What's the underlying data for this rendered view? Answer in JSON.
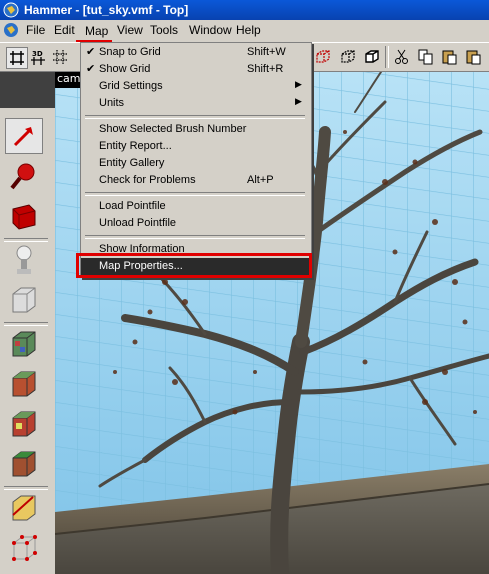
{
  "window": {
    "title": "Hammer - [tut_sky.vmf - Top]"
  },
  "menubar": {
    "items": [
      "File",
      "Edit",
      "Map",
      "View",
      "Tools",
      "Window",
      "Help"
    ]
  },
  "viewport": {
    "tab_label": "cam"
  },
  "map_menu": {
    "items": [
      {
        "label": "Snap to Grid",
        "shortcut": "Shift+W",
        "checked": true
      },
      {
        "label": "Show Grid",
        "shortcut": "Shift+R",
        "checked": true
      },
      {
        "label": "Grid Settings",
        "submenu": true
      },
      {
        "label": "Units",
        "submenu": true
      },
      {
        "label": "Show Selected Brush Number"
      },
      {
        "label": "Entity Report..."
      },
      {
        "label": "Entity Gallery"
      },
      {
        "label": "Check for Problems",
        "shortcut": "Alt+P"
      },
      {
        "label": "Load Pointfile"
      },
      {
        "label": "Unload Pointfile"
      },
      {
        "label": "Show Information"
      },
      {
        "label": "Map Properties...",
        "highlighted": true
      }
    ]
  },
  "colors": {
    "highlight": "#e00000",
    "title_bar": "#0a58d8",
    "sky": "#9fd4f0"
  }
}
